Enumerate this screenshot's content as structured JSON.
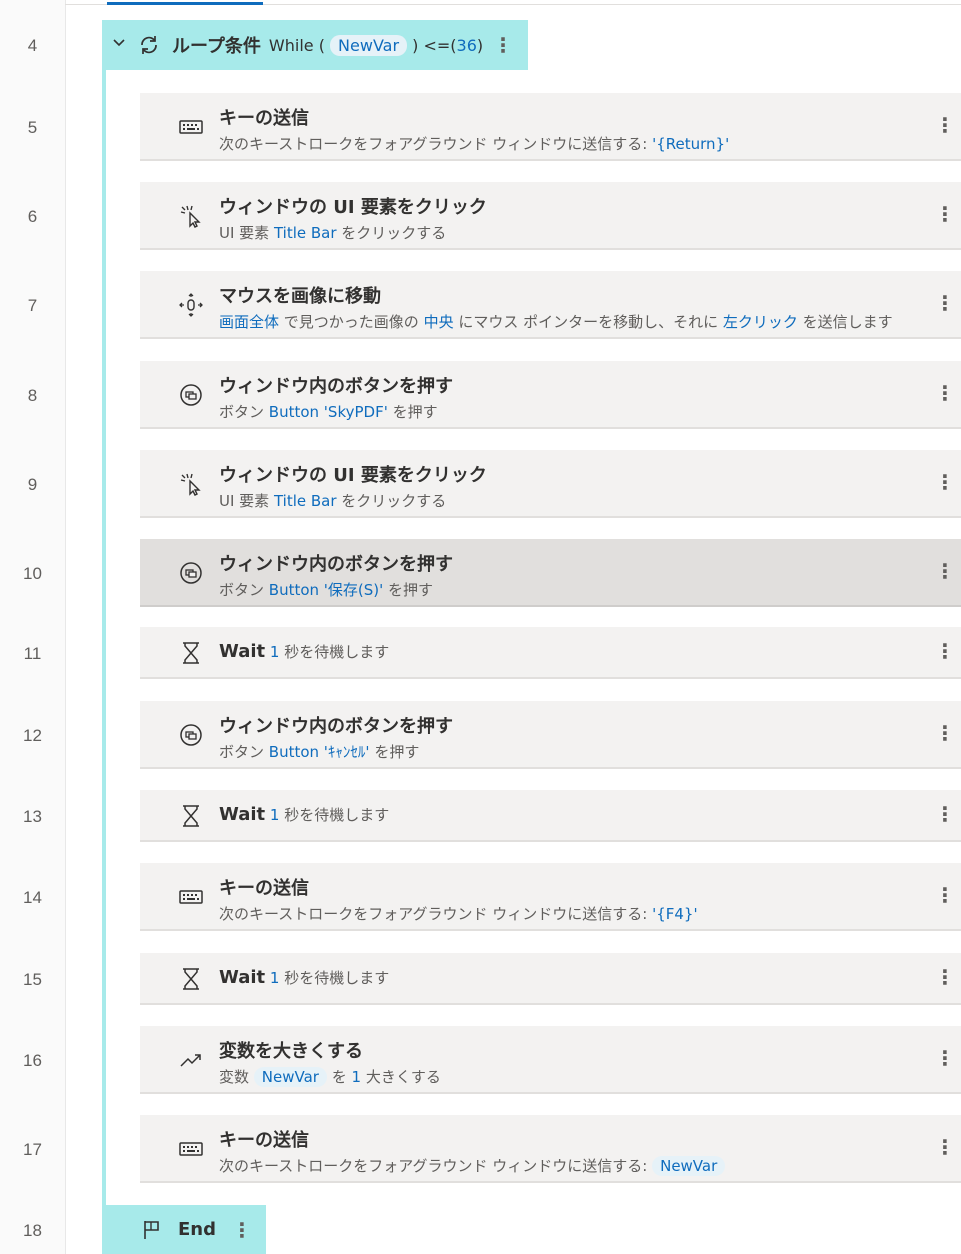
{
  "loop": {
    "line": "4",
    "label": "ループ条件",
    "while_prefix": "While (",
    "var": "NewVar",
    "condition": ") <=(",
    "limit": "36",
    "close": ")"
  },
  "steps": [
    {
      "line": "5",
      "icon": "keyboard-icon",
      "title": "キーの送信",
      "desc_parts": [
        {
          "t": "次のキーストロークをフォアグラウンド ウィンドウに送信する: "
        },
        {
          "t": "'{Return}'",
          "c": "blue"
        }
      ]
    },
    {
      "line": "6",
      "icon": "click-icon",
      "title": "ウィンドウの UI 要素をクリック",
      "desc_parts": [
        {
          "t": "UI 要素 "
        },
        {
          "t": "Title Bar",
          "c": "blue"
        },
        {
          "t": " をクリックする"
        }
      ]
    },
    {
      "line": "7",
      "icon": "move-mouse-icon",
      "title": "マウスを画像に移動",
      "desc_parts": [
        {
          "t": "画面全体",
          "c": "blue"
        },
        {
          "t": " で見つかった画像の "
        },
        {
          "t": "中央",
          "c": "blue"
        },
        {
          "t": " にマウス ポインターを移動し、それに "
        },
        {
          "t": "左クリック",
          "c": "blue"
        },
        {
          "t": " を送信します"
        }
      ]
    },
    {
      "line": "8",
      "icon": "window-button-icon",
      "title": "ウィンドウ内のボタンを押す",
      "desc_parts": [
        {
          "t": "ボタン "
        },
        {
          "t": "Button 'SkyPDF'",
          "c": "blue"
        },
        {
          "t": " を押す"
        }
      ]
    },
    {
      "line": "9",
      "icon": "click-icon",
      "title": "ウィンドウの UI 要素をクリック",
      "desc_parts": [
        {
          "t": "UI 要素 "
        },
        {
          "t": "Title Bar",
          "c": "blue"
        },
        {
          "t": " をクリックする"
        }
      ]
    },
    {
      "line": "10",
      "icon": "window-button-icon",
      "title": "ウィンドウ内のボタンを押す",
      "selected": true,
      "desc_parts": [
        {
          "t": "ボタン "
        },
        {
          "t": "Button '保存(S)'",
          "c": "blue"
        },
        {
          "t": " を押す"
        }
      ]
    },
    {
      "line": "11",
      "icon": "hourglass-icon",
      "title": "Wait",
      "single": true,
      "desc_parts": [
        {
          "t": "1",
          "c": "blue"
        },
        {
          "t": " 秒を待機します"
        }
      ]
    },
    {
      "line": "12",
      "icon": "window-button-icon",
      "title": "ウィンドウ内のボタンを押す",
      "desc_parts": [
        {
          "t": "ボタン "
        },
        {
          "t": "Button 'ｷｬﾝｾﾙ'",
          "c": "blue"
        },
        {
          "t": " を押す"
        }
      ]
    },
    {
      "line": "13",
      "icon": "hourglass-icon",
      "title": "Wait",
      "single": true,
      "desc_parts": [
        {
          "t": "1",
          "c": "blue"
        },
        {
          "t": " 秒を待機します"
        }
      ]
    },
    {
      "line": "14",
      "icon": "keyboard-icon",
      "title": "キーの送信",
      "desc_parts": [
        {
          "t": "次のキーストロークをフォアグラウンド ウィンドウに送信する: "
        },
        {
          "t": "'{F4}'",
          "c": "blue"
        }
      ]
    },
    {
      "line": "15",
      "icon": "hourglass-icon",
      "title": "Wait",
      "single": true,
      "desc_parts": [
        {
          "t": "1",
          "c": "blue"
        },
        {
          "t": " 秒を待機します"
        }
      ]
    },
    {
      "line": "16",
      "icon": "increase-icon",
      "title": "変数を大きくする",
      "desc_parts": [
        {
          "t": "変数 "
        },
        {
          "t": "NewVar",
          "c": "pill"
        },
        {
          "t": " を "
        },
        {
          "t": "1",
          "c": "blue"
        },
        {
          "t": " 大きくする"
        }
      ]
    },
    {
      "line": "17",
      "icon": "keyboard-icon",
      "title": "キーの送信",
      "desc_parts": [
        {
          "t": "次のキーストロークをフォアグラウンド ウィンドウに送信する: "
        },
        {
          "t": "NewVar",
          "c": "pill"
        }
      ]
    }
  ],
  "end": {
    "line": "18",
    "label": "End"
  },
  "menu_glyph": "⋮"
}
